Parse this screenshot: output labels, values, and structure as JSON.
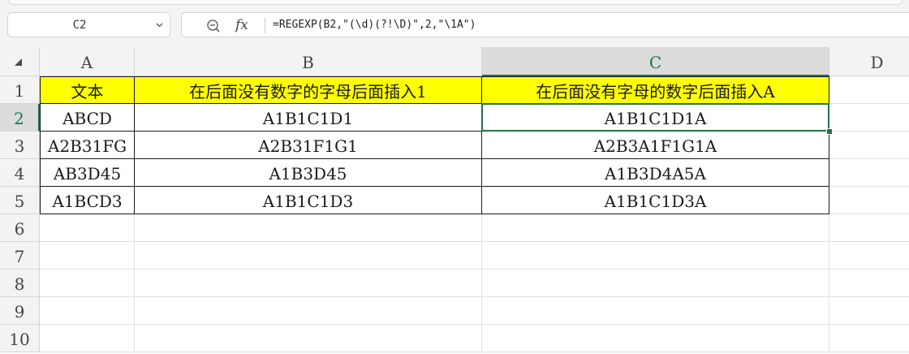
{
  "name_box": {
    "value": "C2"
  },
  "formula_bar": {
    "fx_label": "fx",
    "formula": "=REGEXP(B2,\"(\\d)(?!\\D)\",2,\"\\1A\")"
  },
  "icons": {
    "name_box_dropdown": "chevron-down-icon",
    "zoom": "zoom-out-icon",
    "function": "fx-icon",
    "select_all": "select-all-triangle-icon"
  },
  "columns": [
    "A",
    "B",
    "C",
    "D"
  ],
  "active_column": "C",
  "rows": [
    "1",
    "2",
    "3",
    "4",
    "5",
    "6",
    "7",
    "8",
    "9",
    "10"
  ],
  "active_row": "2",
  "colors": {
    "header_fill": "#ffff00",
    "selection": "#217346"
  },
  "table": {
    "headers": [
      "文本",
      "在后面没有数字的字母后面插入1",
      "在后面没有字母的数字后面插入A"
    ],
    "rows": [
      [
        "ABCD",
        "A1B1C1D1",
        "A1B1C1D1A"
      ],
      [
        "A2B31FG",
        "A2B31F1G1",
        "A2B3A1F1G1A"
      ],
      [
        "AB3D45",
        "A1B3D45",
        "A1B3D4A5A"
      ],
      [
        "A1BCD3",
        "A1B1C1D3",
        "A1B1C1D3A"
      ]
    ]
  }
}
